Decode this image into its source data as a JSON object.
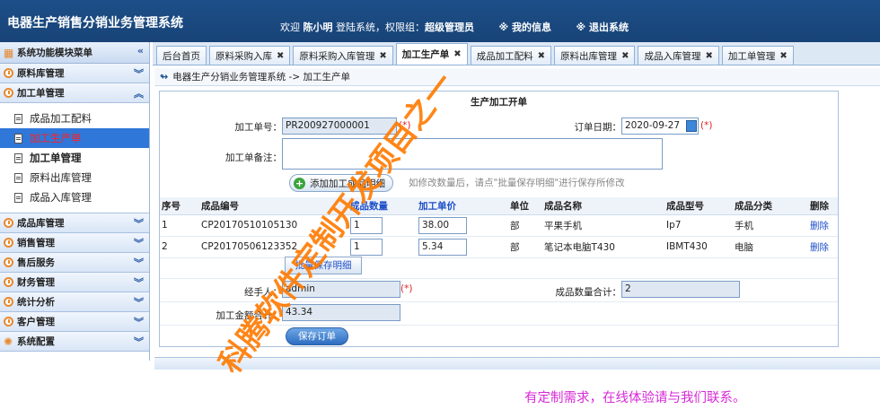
{
  "header": {
    "app_title": "电器生产销售分销业务管理系统",
    "welcome_prefix": "欢迎",
    "user_name": "陈小明",
    "login_text": "登陆系统，权限组：",
    "role": "超级管理员",
    "my_info": "※ 我的信息",
    "logout": "※ 退出系统"
  },
  "sidebar": {
    "header": "系统功能模块菜单",
    "groups": [
      {
        "label": "原料库管理"
      },
      {
        "label": "加工单管理"
      },
      {
        "label": "成品库管理"
      },
      {
        "label": "销售管理"
      },
      {
        "label": "售后服务"
      },
      {
        "label": "财务管理"
      },
      {
        "label": "统计分析"
      },
      {
        "label": "客户管理"
      },
      {
        "label": "系统配置"
      }
    ],
    "sub_items": [
      {
        "label": "成品加工配料"
      },
      {
        "label": "加工生产单"
      },
      {
        "label": "加工单管理"
      },
      {
        "label": "原料出库管理"
      },
      {
        "label": "成品入库管理"
      }
    ]
  },
  "tabs": [
    {
      "label": "后台首页"
    },
    {
      "label": "原料采购入库"
    },
    {
      "label": "原料采购入库管理"
    },
    {
      "label": "加工生产单"
    },
    {
      "label": "成品加工配料"
    },
    {
      "label": "原料出库管理"
    },
    {
      "label": "成品入库管理"
    },
    {
      "label": "加工单管理"
    }
  ],
  "breadcrumb": "电器生产分销业务管理系统 -> 加工生产单",
  "form": {
    "title": "生产加工开单",
    "order_no_label": "加工单号：",
    "order_no": "PR200927000001",
    "required_mark": "(*)",
    "date_label": "订单日期：",
    "date": "2020-09-27",
    "remark_label": "加工单备注：",
    "add_button": "添加加工成品明细",
    "hint": "如修改数量后，请点\"批量保存明细\"进行保存所修改",
    "batch_button": "批量保存明细",
    "handler_label": "经手人：",
    "handler": "admin",
    "total_qty_label": "成品数量合计：",
    "total_qty": "2",
    "total_amount_label": "加工金额合计：",
    "total_amount": "43.34",
    "save_button": "保存订单"
  },
  "table": {
    "headers": [
      "序号",
      "成品编号",
      "成品数量",
      "加工单价",
      "单位",
      "成品名称",
      "成品型号",
      "成品分类",
      "删除"
    ],
    "rows": [
      {
        "no": "1",
        "code": "CP20170510105130",
        "qty": "1",
        "price": "38.00",
        "unit": "部",
        "name": "平果手机",
        "model": "Ip7",
        "category": "手机",
        "del": "删除"
      },
      {
        "no": "2",
        "code": "CP20170506123352",
        "qty": "1",
        "price": "5.34",
        "unit": "部",
        "name": "笔记本电脑T430",
        "model": "IBMT430",
        "category": "电脑",
        "del": "删除"
      }
    ]
  },
  "watermark": "科腾软件定制开发项目之一",
  "contact": "有定制需求，在线体验请与我们联系。",
  "colors": {
    "header_bg": "#1e4f88",
    "active_item_bg": "#2f77d8",
    "active_item_text": "#ff2020",
    "watermark": "#ff7a00",
    "contact": "#d62ad6"
  }
}
